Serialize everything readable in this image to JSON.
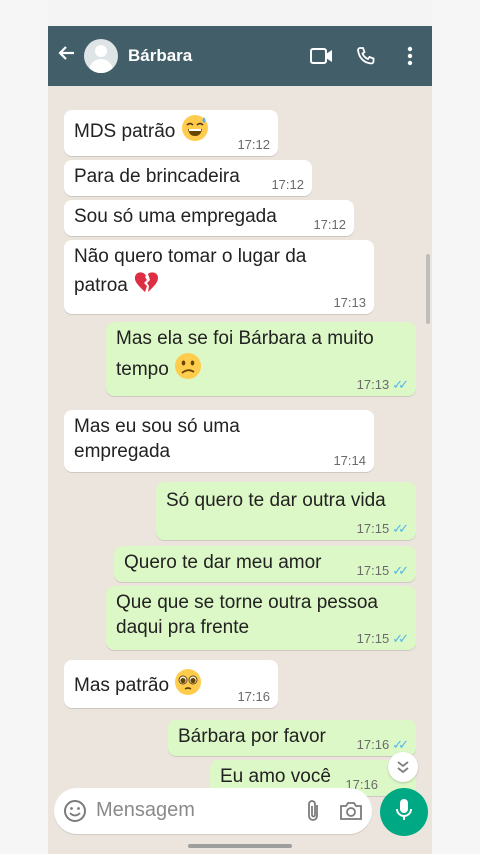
{
  "header": {
    "contact_name": "Bárbara"
  },
  "messages": [
    {
      "dir": "in",
      "lines": [
        "MDS patrão"
      ],
      "emoji": "sweat-smile",
      "time": "17:12"
    },
    {
      "dir": "in",
      "lines": [
        "Para de brincadeira"
      ],
      "time": "17:12"
    },
    {
      "dir": "in",
      "lines": [
        "Sou só uma empregada"
      ],
      "time": "17:12"
    },
    {
      "dir": "in",
      "lines": [
        "Não quero tomar o lugar da",
        "patroa"
      ],
      "emoji": "broken-heart",
      "time": "17:13"
    },
    {
      "dir": "out",
      "lines": [
        "Mas ela se foi Bárbara a muito",
        "tempo"
      ],
      "emoji": "confused-face",
      "time": "17:13"
    },
    {
      "dir": "in",
      "lines": [
        "Mas eu sou só uma",
        "empregada"
      ],
      "time": "17:14"
    },
    {
      "dir": "out",
      "lines": [
        "Só quero te dar outra vida"
      ],
      "time": "17:15"
    },
    {
      "dir": "out",
      "lines": [
        "Quero te dar meu amor"
      ],
      "time": "17:15"
    },
    {
      "dir": "out",
      "lines": [
        "Que que se torne outra pessoa",
        "daqui pra frente"
      ],
      "time": "17:15"
    },
    {
      "dir": "in",
      "lines": [
        "Mas patrão"
      ],
      "emoji": "pleading-face",
      "time": "17:16"
    },
    {
      "dir": "out",
      "lines": [
        "Bárbara por favor"
      ],
      "time": "17:16"
    },
    {
      "dir": "out",
      "lines": [
        "Eu amo você"
      ],
      "time": "17:16"
    }
  ],
  "composer": {
    "placeholder": "Mensagem"
  },
  "colors": {
    "header": "#425e69",
    "outgoing": "#dcf8c6",
    "incoming": "#ffffff",
    "accent": "#00a884",
    "read_ticks": "#4fb6ec"
  },
  "icons": [
    "back-arrow-icon",
    "avatar-icon",
    "video-call-icon",
    "phone-icon",
    "more-vert-icon",
    "emoji-icon",
    "attach-icon",
    "camera-icon",
    "mic-icon",
    "chevron-double-down-icon"
  ]
}
